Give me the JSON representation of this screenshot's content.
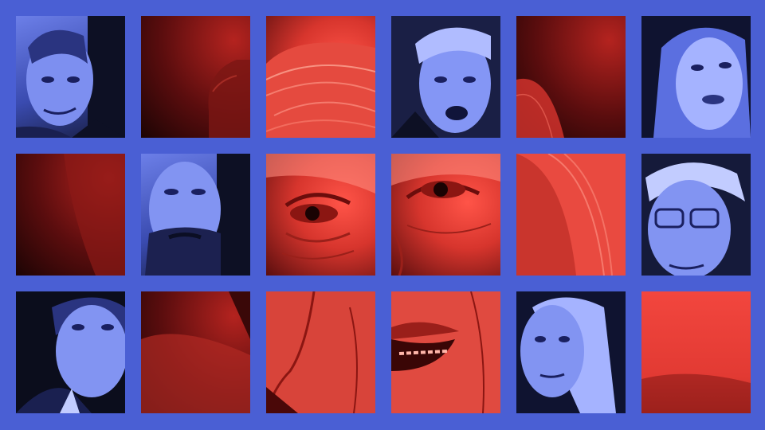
{
  "image": {
    "palette": {
      "background": "#4a5fd4",
      "red_tone": "#e03a32",
      "blue_tone": "#5b6fe0",
      "shadow": "#0d1024"
    },
    "tiles": [
      {
        "name": "portrait-older-man-blue",
        "tone": "blue"
      },
      {
        "name": "abstract-red-dark",
        "tone": "red"
      },
      {
        "name": "center-face-hair-red",
        "tone": "red"
      },
      {
        "name": "portrait-man-speaking-blue",
        "tone": "blue"
      },
      {
        "name": "abstract-red-gradient",
        "tone": "red"
      },
      {
        "name": "portrait-woman-speaking-blue",
        "tone": "blue"
      },
      {
        "name": "abstract-red-dark-2",
        "tone": "red"
      },
      {
        "name": "portrait-bearded-man-blue",
        "tone": "blue"
      },
      {
        "name": "center-face-left-eye-red",
        "tone": "red"
      },
      {
        "name": "center-face-right-eye-red",
        "tone": "red"
      },
      {
        "name": "center-face-hair-side-red",
        "tone": "red"
      },
      {
        "name": "portrait-man-glasses-blue",
        "tone": "blue"
      },
      {
        "name": "portrait-man-suit-blue",
        "tone": "blue"
      },
      {
        "name": "abstract-red-dark-3",
        "tone": "red"
      },
      {
        "name": "center-face-cheek-red",
        "tone": "red"
      },
      {
        "name": "center-face-mouth-red",
        "tone": "red"
      },
      {
        "name": "portrait-woman-blonde-blue",
        "tone": "blue"
      },
      {
        "name": "abstract-red-bright",
        "tone": "red"
      }
    ]
  }
}
